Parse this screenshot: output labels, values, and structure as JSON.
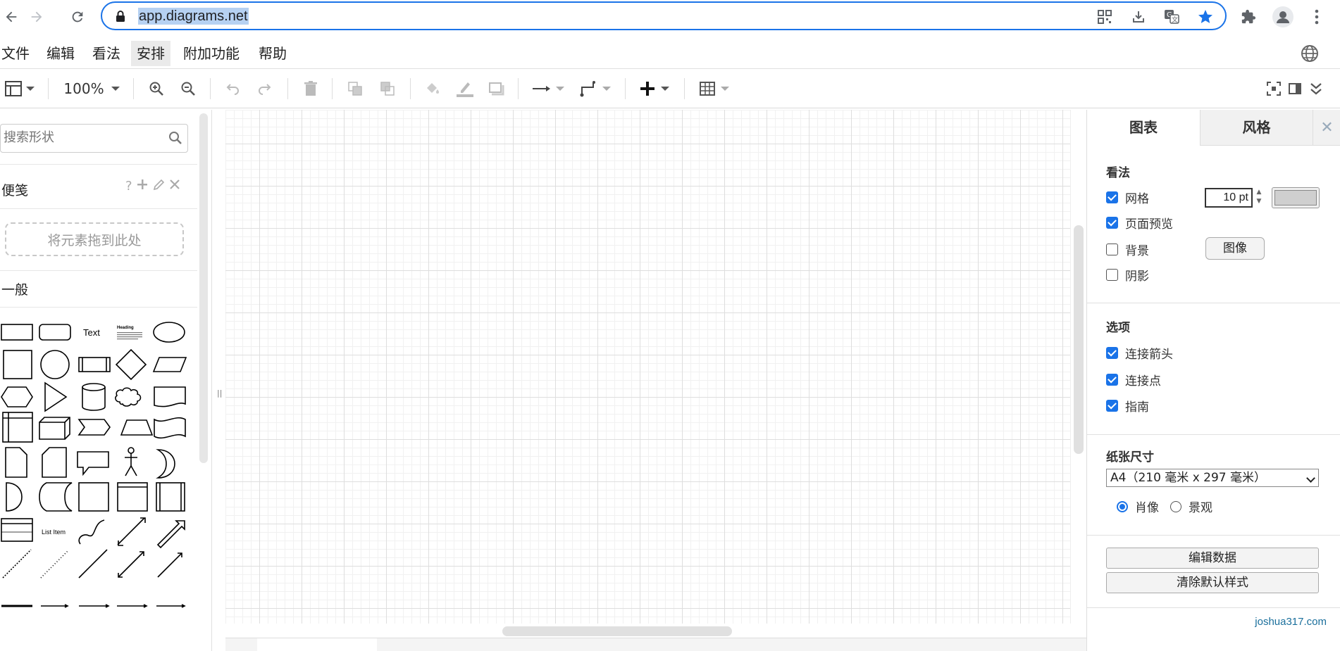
{
  "browser": {
    "url": "app.diagrams.net"
  },
  "menubar": {
    "items": [
      {
        "label": "文件"
      },
      {
        "label": "编辑"
      },
      {
        "label": "看法"
      },
      {
        "label": "安排"
      },
      {
        "label": "附加功能"
      },
      {
        "label": "帮助"
      }
    ],
    "active": "安排"
  },
  "toolbar": {
    "zoom": "100%"
  },
  "sidebar": {
    "search_placeholder": "搜索形状",
    "scratchpad_title": "便笺",
    "scratchpad_help": "?",
    "drop_zone_text": "将元素拖到此处",
    "general_title": "一般",
    "shape_text_label": "Text",
    "shape_heading_label": "Heading",
    "shape_list_item_label": "List Item"
  },
  "right_panel": {
    "tabs": [
      {
        "label": "图表"
      },
      {
        "label": "风格"
      }
    ],
    "view_section": {
      "title": "看法",
      "grid": {
        "label": "网格",
        "checked": true,
        "size": "10 pt",
        "color": "#cfcfcf"
      },
      "page_view": {
        "label": "页面预览",
        "checked": true
      },
      "background": {
        "label": "背景",
        "checked": false,
        "button": "图像"
      },
      "shadow": {
        "label": "阴影",
        "checked": false
      }
    },
    "options_section": {
      "title": "选项",
      "connection_arrows": {
        "label": "连接箭头",
        "checked": true
      },
      "connection_points": {
        "label": "连接点",
        "checked": true
      },
      "guides": {
        "label": "指南",
        "checked": true
      }
    },
    "paper_section": {
      "title": "纸张尺寸",
      "size": "A4（210 毫米 x 297 毫米）",
      "portrait": "肖像",
      "landscape": "景观",
      "orientation": "portrait"
    },
    "buttons": {
      "edit_data": "编辑数据",
      "clear_default_style": "清除默认样式"
    }
  },
  "watermark": "joshua317.com",
  "colors": {
    "accent": "#1a73e8",
    "grid_major": "#dedede",
    "grid_minor": "#f1f1f1"
  }
}
